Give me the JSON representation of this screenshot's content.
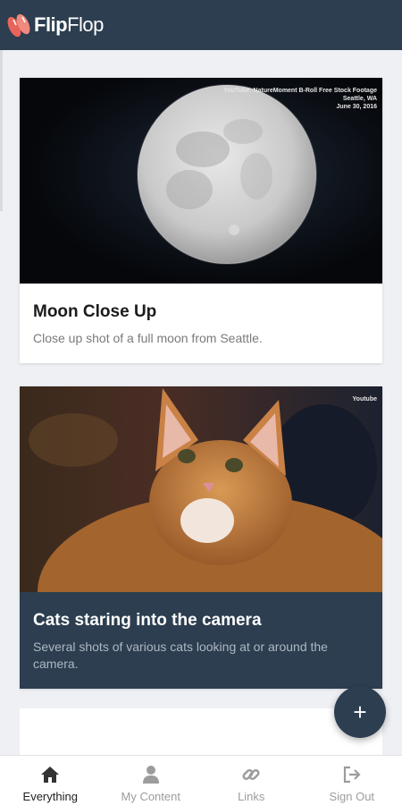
{
  "app": {
    "name_bold": "Flip",
    "name_light": "Flop"
  },
  "cards": [
    {
      "title": "Moon Close Up",
      "description": "Close up shot of a full moon from Seattle.",
      "caption": [
        "YouTube: NatureMoment B-Roll Free Stock Footage",
        "Seattle, WA",
        "June 30, 2016"
      ]
    },
    {
      "title": "Cats staring into the camera",
      "description": "Several shots of various cats looking at or around the camera.",
      "caption": [
        "Youtube"
      ]
    }
  ],
  "fab": {
    "label": "+"
  },
  "nav": [
    {
      "label": "Everything",
      "icon": "home-icon",
      "active": true
    },
    {
      "label": "My Content",
      "icon": "user-icon",
      "active": false
    },
    {
      "label": "Links",
      "icon": "link-icon",
      "active": false
    },
    {
      "label": "Sign Out",
      "icon": "sign-out-icon",
      "active": false
    }
  ],
  "colors": {
    "header": "#2c3e50",
    "accent": "#2c3e50",
    "logo": "#e8645a"
  }
}
